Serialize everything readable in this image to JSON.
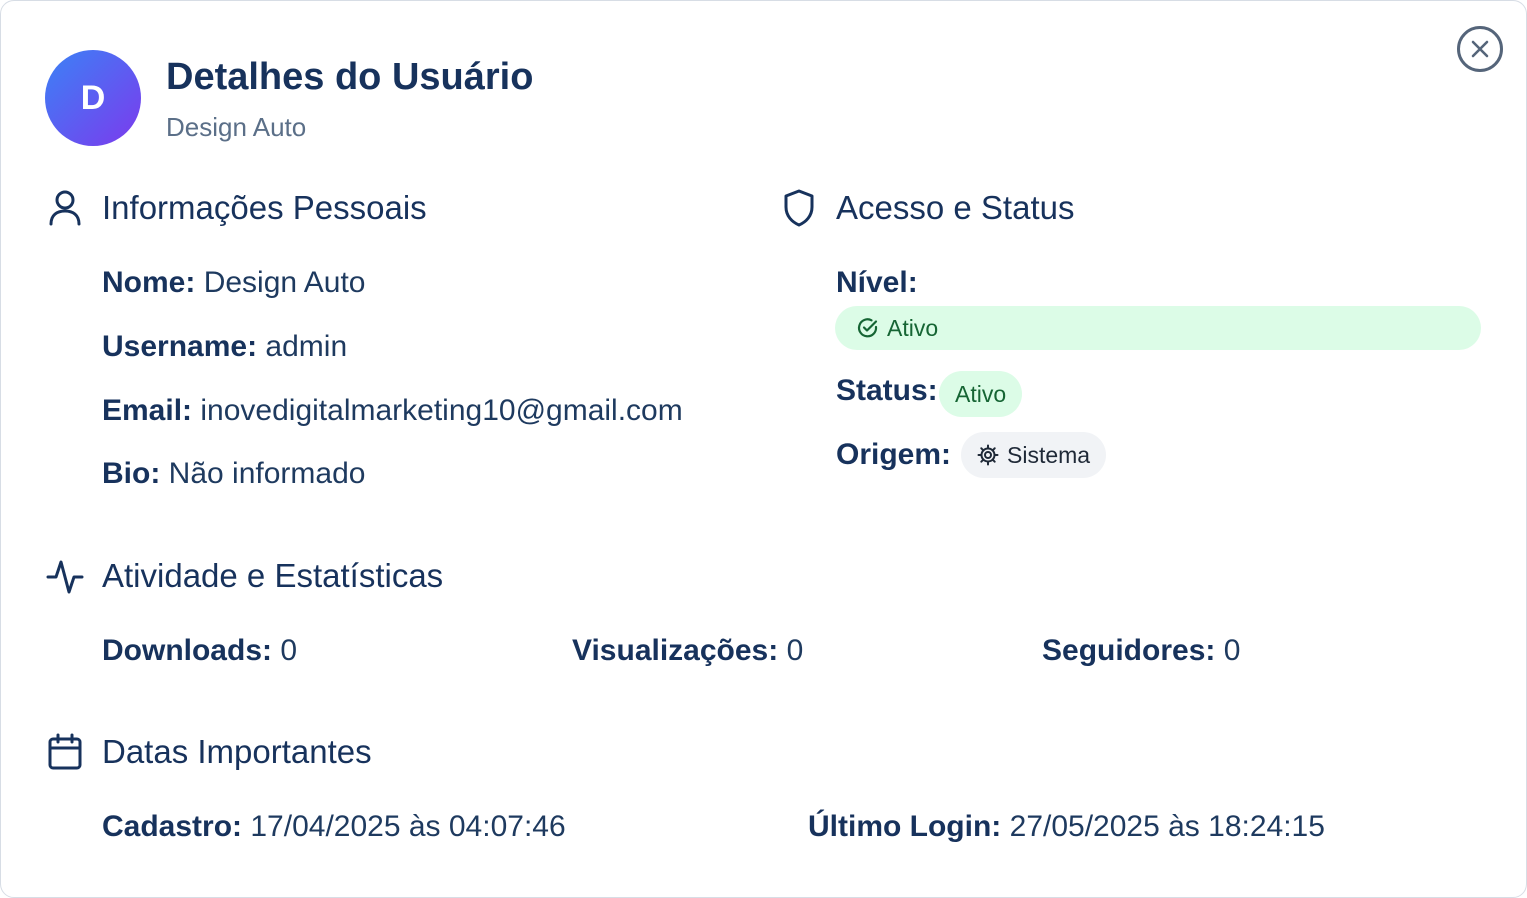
{
  "header": {
    "avatar_initial": "D",
    "title": "Detalhes do Usuário",
    "subtitle": "Design Auto",
    "close_icon": "close-circle-icon"
  },
  "personal": {
    "title": "Informações Pessoais",
    "icon": "user-icon",
    "fields": [
      {
        "label": "Nome:",
        "value": "Design Auto"
      },
      {
        "label": "Username:",
        "value": "admin"
      },
      {
        "label": "Email:",
        "value": "inovedigitalmarketing10@gmail.com"
      },
      {
        "label": "Bio:",
        "value": "Não informado"
      }
    ]
  },
  "access": {
    "title": "Acesso e Status",
    "icon": "shield-icon",
    "level_label": "Nível:",
    "level_value": "Ativo",
    "status_label": "Status:",
    "status_value": "Ativo",
    "origin_label": "Origem:",
    "origin_value": "Sistema"
  },
  "activity": {
    "title": "Atividade e Estatísticas",
    "icon": "activity-icon",
    "stats": [
      {
        "label": "Downloads:",
        "value": "0"
      },
      {
        "label": "Visualizações:",
        "value": "0"
      },
      {
        "label": "Seguidores:",
        "value": "0"
      }
    ]
  },
  "dates": {
    "title": "Datas Importantes",
    "icon": "calendar-icon",
    "items": [
      {
        "label": "Cadastro:",
        "value": "17/04/2025 às 04:07:46"
      },
      {
        "label": "Último Login:",
        "value": "27/05/2025 às 18:24:15"
      }
    ]
  },
  "colors": {
    "primary_text": "#17325c",
    "secondary_text": "#5b6f88",
    "success_bg": "#dcfce7",
    "success_text": "#166534",
    "neutral_bg": "#f1f3f6",
    "avatar_gradient_start": "#3b82f6",
    "avatar_gradient_end": "#7c3aed"
  }
}
